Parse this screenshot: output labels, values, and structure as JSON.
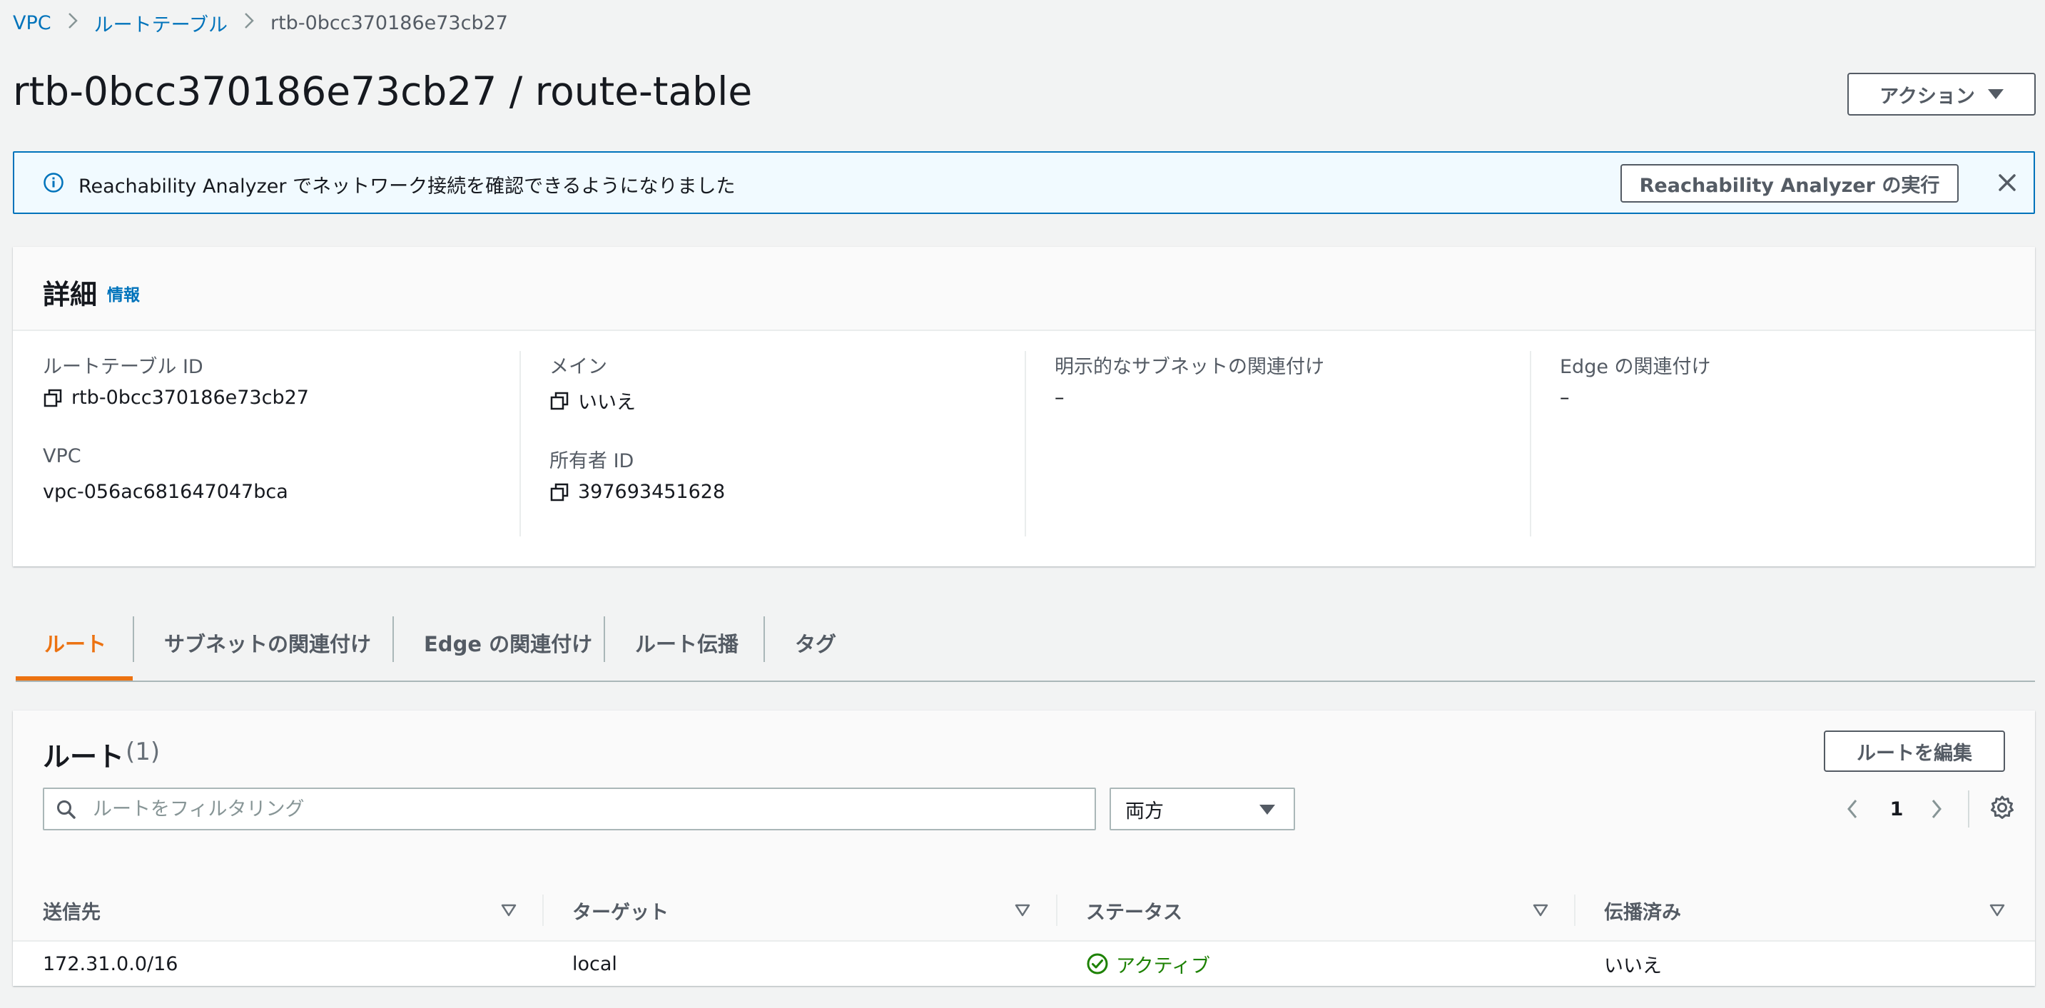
{
  "breadcrumb": {
    "items": [
      "VPC",
      "ルートテーブル"
    ],
    "current": "rtb-0bcc370186e73cb27"
  },
  "header": {
    "title": "rtb-0bcc370186e73cb27 / route-table",
    "actions_label": "アクション"
  },
  "flash": {
    "message": "Reachability Analyzer でネットワーク接続を確認できるようになりました",
    "button_label": "Reachability Analyzer の実行"
  },
  "details": {
    "title": "詳細",
    "info_link": "情報",
    "fields": {
      "route_table_id_label": "ルートテーブル ID",
      "route_table_id_value": "rtb-0bcc370186e73cb27",
      "vpc_label": "VPC",
      "vpc_value": "vpc-056ac681647047bca",
      "main_label": "メイン",
      "main_value": "いいえ",
      "owner_label": "所有者 ID",
      "owner_value": "397693451628",
      "subnet_assoc_label": "明示的なサブネットの関連付け",
      "subnet_assoc_value": "–",
      "edge_assoc_label": "Edge の関連付け",
      "edge_assoc_value": "–"
    }
  },
  "tabs": [
    "ルート",
    "サブネットの関連付け",
    "Edge の関連付け",
    "ルート伝播",
    "タグ"
  ],
  "routes": {
    "title": "ルート",
    "count": "(1)",
    "edit_label": "ルートを編集",
    "filter_placeholder": "ルートをフィルタリング",
    "select_value": "両方",
    "page": "1",
    "columns": [
      "送信先",
      "ターゲット",
      "ステータス",
      "伝播済み"
    ],
    "rows": [
      {
        "destination": "172.31.0.0/16",
        "target": "local",
        "status": "アクティブ",
        "propagated": "いいえ"
      }
    ]
  },
  "colors": {
    "link": "#0073bb",
    "active_tab": "#ec7211",
    "status_active": "#1d8102",
    "flash_border": "#0073bb"
  },
  "icons": [
    "chevron-right-icon",
    "caret-down-icon",
    "info-icon",
    "close-icon",
    "copy-icon",
    "search-icon",
    "chevron-left-icon",
    "settings-icon",
    "sort-icon",
    "check-circle-icon"
  ]
}
